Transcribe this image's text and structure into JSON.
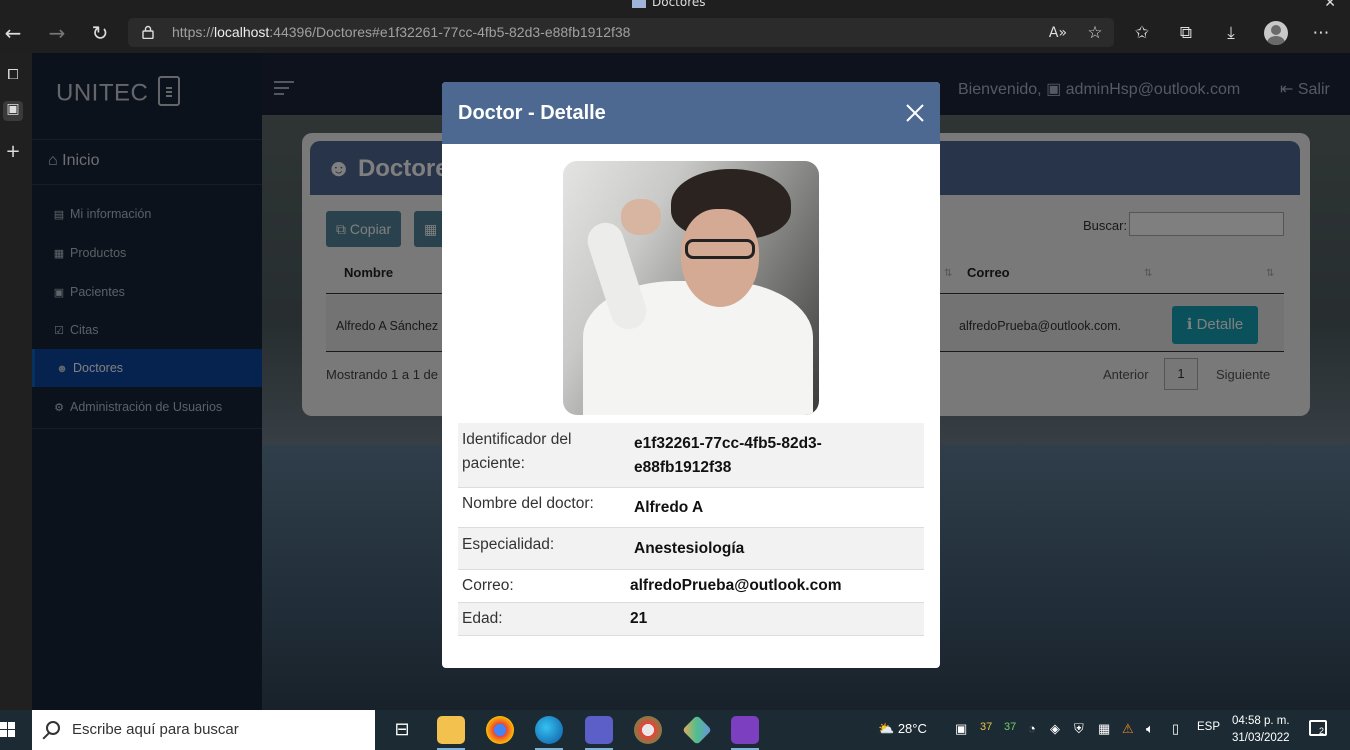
{
  "browser": {
    "window_title": "Doctores",
    "url_prefix": "https://",
    "url_host": "localhost",
    "url_rest": ":44396/Doctores#e1f32261-77cc-4fb5-82d3-e88fb1912f38"
  },
  "sidebar": {
    "brand": "UNITEC",
    "home_label": "Inicio",
    "items": [
      {
        "label": "Mi información",
        "icon": "id-card-icon"
      },
      {
        "label": "Productos",
        "icon": "box-icon"
      },
      {
        "label": "Pacientes",
        "icon": "patient-badge-icon"
      },
      {
        "label": "Citas",
        "icon": "calendar-check-icon"
      },
      {
        "label": "Doctores",
        "icon": "users-icon",
        "active": true
      },
      {
        "label": "Administración de Usuarios",
        "icon": "users-cog-icon"
      }
    ]
  },
  "topbar": {
    "welcome_prefix": "Bienvenido,",
    "user_email": "adminHsp@outlook.com",
    "logout_label": "Salir"
  },
  "page": {
    "card_title": "Doctores",
    "copy_button": "Copiar",
    "search_label": "Buscar:",
    "search_value": "",
    "columns": [
      "Nombre",
      "Correo"
    ],
    "rows": [
      {
        "nombre": "Alfredo A Sánchez",
        "correo": "alfredoPrueba@outlook.com.",
        "action": "Detalle"
      }
    ],
    "info_text": "Mostrando 1 a 1 de",
    "pager": {
      "prev": "Anterior",
      "page": "1",
      "next": "Siguiente"
    }
  },
  "modal": {
    "title": "Doctor - Detalle",
    "fields": [
      {
        "label": "Identificador del paciente:",
        "value": "e1f32261-77cc-4fb5-82d3-e88fb1912f38"
      },
      {
        "label": "Nombre del doctor:",
        "value": "Alfredo A"
      },
      {
        "label": "Especialidad:",
        "value": "Anestesiología"
      },
      {
        "label": "Correo:",
        "value": "alfredoPrueba@outlook.com"
      },
      {
        "label": "Edad:",
        "value": "21"
      }
    ]
  },
  "taskbar": {
    "search_placeholder": "Escribe aquí para buscar",
    "temperature": "28°C",
    "badge_a": "37",
    "badge_b": "37",
    "language": "ESP",
    "time": "04:58 p. m.",
    "date": "31/03/2022",
    "notifications": "2"
  }
}
